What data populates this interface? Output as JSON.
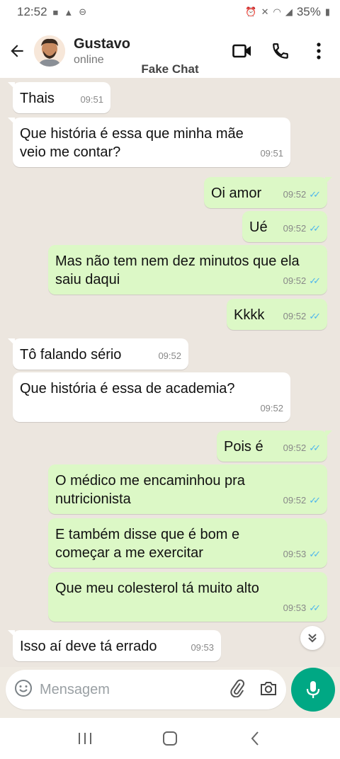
{
  "status_bar": {
    "time": "12:52",
    "battery": "35%"
  },
  "header": {
    "contact_name": "Gustavo",
    "contact_status": "online",
    "overlay_label": "Fake Chat"
  },
  "messages": [
    {
      "dir": "in",
      "text": "Thais",
      "time": "09:51"
    },
    {
      "dir": "in",
      "text": "Que história é essa que minha mãe veio me contar?",
      "time": "09:51"
    },
    {
      "dir": "out",
      "text": "Oi amor",
      "time": "09:52"
    },
    {
      "dir": "out",
      "text": "Ué",
      "time": "09:52"
    },
    {
      "dir": "out",
      "text": "Mas não tem nem dez minutos que ela saiu daqui",
      "time": "09:52"
    },
    {
      "dir": "out",
      "text": "Kkkk",
      "time": "09:52"
    },
    {
      "dir": "in",
      "text": "Tô falando sério",
      "time": "09:52"
    },
    {
      "dir": "in",
      "text": "Que história é essa de academia?",
      "time": "09:52"
    },
    {
      "dir": "out",
      "text": "Pois é",
      "time": "09:52"
    },
    {
      "dir": "out",
      "text": "O médico me encaminhou pra nutricionista",
      "time": "09:52"
    },
    {
      "dir": "out",
      "text": "E também disse que é bom e começar a me exercitar",
      "time": "09:53"
    },
    {
      "dir": "out",
      "text": "Que meu colesterol tá muito alto",
      "time": "09:53"
    },
    {
      "dir": "in",
      "text": "Isso aí deve tá errado",
      "time": "09:53"
    }
  ],
  "composer": {
    "placeholder": "Mensagem"
  },
  "colors": {
    "accent": "#00a884",
    "outgoing_bubble": "#dcf8c6",
    "incoming_bubble": "#ffffff",
    "read_ticks": "#4fb6ec"
  }
}
